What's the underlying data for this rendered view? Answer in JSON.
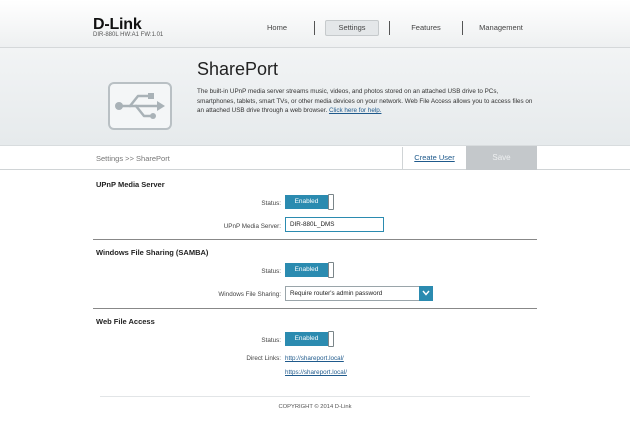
{
  "header": {
    "brand": "D-Link",
    "model_info": "DIR-880L   HW:A1   FW:1.01",
    "nav": [
      "Home",
      "Settings",
      "Features",
      "Management"
    ]
  },
  "banner": {
    "title": "SharePort",
    "description": "The built-in UPnP media server streams music, videos, and photos stored on an attached USB drive to PCs, smartphones, tablets, smart TVs, or other media devices on your network. Web File Access allows you to access files on an attached USB drive through a web browser.",
    "help_link": "Click here for help.",
    "icon": "usb-drive-icon"
  },
  "toolbar": {
    "breadcrumb": "Settings >> SharePort",
    "create_user": "Create User",
    "save": "Save"
  },
  "upnp": {
    "title": "UPnP Media Server",
    "status_label": "Status:",
    "status_value": "Enabled",
    "server_label": "UPnP Media Server:",
    "server_value": "DIR-880L_DMS"
  },
  "samba": {
    "title": "Windows File Sharing (SAMBA)",
    "status_label": "Status:",
    "status_value": "Enabled",
    "sharing_label": "Windows File Sharing:",
    "sharing_value": "Require router's admin password"
  },
  "web_access": {
    "title": "Web File Access",
    "status_label": "Status:",
    "status_value": "Enabled",
    "links_label": "Direct Links:",
    "links": [
      "http://shareport.local/",
      "https://shareport.local/"
    ]
  },
  "footer": {
    "copyright": "COPYRIGHT © 2014 D-Link"
  },
  "colors": {
    "accent": "#2b8bb0",
    "link": "#1f5a8c",
    "save_disabled": "#c4c8cb"
  }
}
